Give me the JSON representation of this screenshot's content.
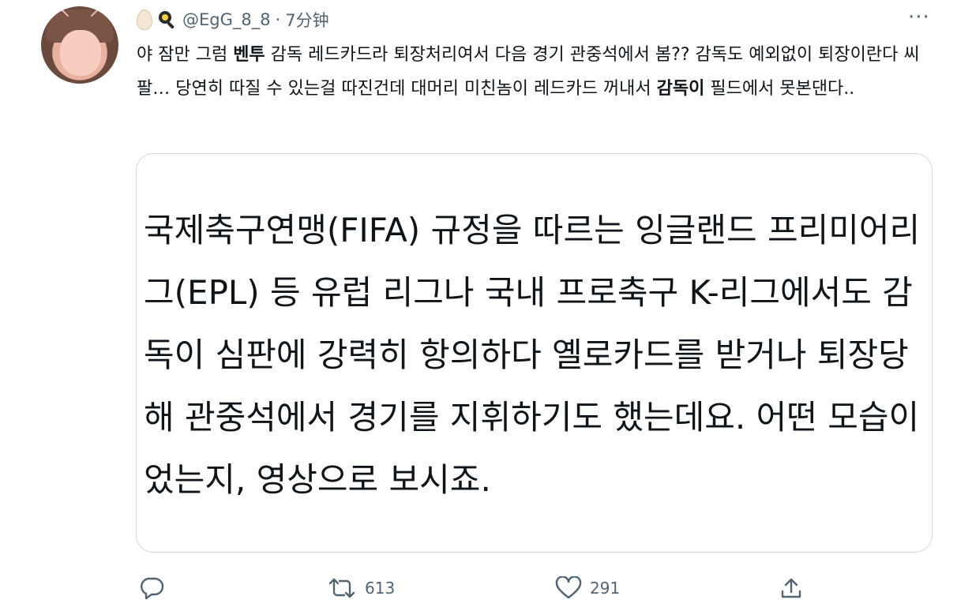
{
  "tweet": {
    "handle": "@EgG_8_8",
    "separator": "·",
    "time": "7分钟",
    "text_parts": [
      {
        "text": "야 잠만 그럼 ",
        "bold": false
      },
      {
        "text": "벤투",
        "bold": true
      },
      {
        "text": " 감독 레드카드라 퇴장처리여서 다음 경기 관중석에서 봄?? 감독도 예외없이 퇴장이란다 씨팔… 당연히 따질 수 있는걸 따진건데 대머리 미친놈이 레드카드 꺼내서 ",
        "bold": false
      },
      {
        "text": "감독이",
        "bold": true
      },
      {
        "text": " 필드에서 못본댄다..",
        "bold": false
      }
    ],
    "icons": [
      "egg-icon",
      "frying-pan-icon",
      "more-icon"
    ]
  },
  "quote": {
    "text": "국제축구연맹(FIFA) 규정을 따르는 잉글랜드 프리미어리그(EPL) 등 유럽 리그나 국내 프로축구 K-리그에서도 감독이 심판에 강력히 항의하다 옐로카드를 받거나 퇴장당해 관중석에서 경기를 지휘하기도 했는데요. 어떤 모습이었는지, 영상으로 보시죠."
  },
  "actions": {
    "reply": {
      "icon": "reply-icon",
      "count": ""
    },
    "retweet": {
      "icon": "retweet-icon",
      "count": "613"
    },
    "like": {
      "icon": "heart-icon",
      "count": "291"
    },
    "share": {
      "icon": "share-icon",
      "count": ""
    }
  },
  "colors": {
    "text": "#0f1419",
    "secondary": "#536471",
    "border": "#cfd9de"
  }
}
